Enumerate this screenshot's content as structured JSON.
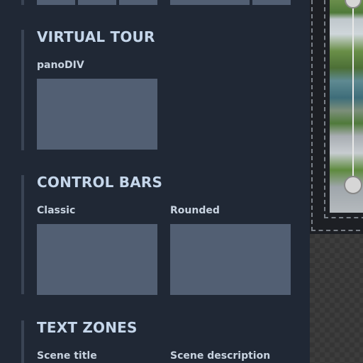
{
  "sections": [
    {
      "title": "VIRTUAL TOUR",
      "items": [
        {
          "label": "panoDIV"
        }
      ]
    },
    {
      "title": "CONTROL BARS",
      "items": [
        {
          "label": "Classic"
        },
        {
          "label": "Rounded"
        }
      ]
    },
    {
      "title": "TEXT ZONES",
      "items": [
        {
          "label": "Scene title"
        },
        {
          "label": "Scene description"
        }
      ]
    }
  ],
  "colors": {
    "panel_bg": "#202835",
    "heading": "#c5d6ea",
    "label": "#c8d3e0",
    "thumbnail": "#525f73",
    "accent_bar": "#3a4454"
  }
}
